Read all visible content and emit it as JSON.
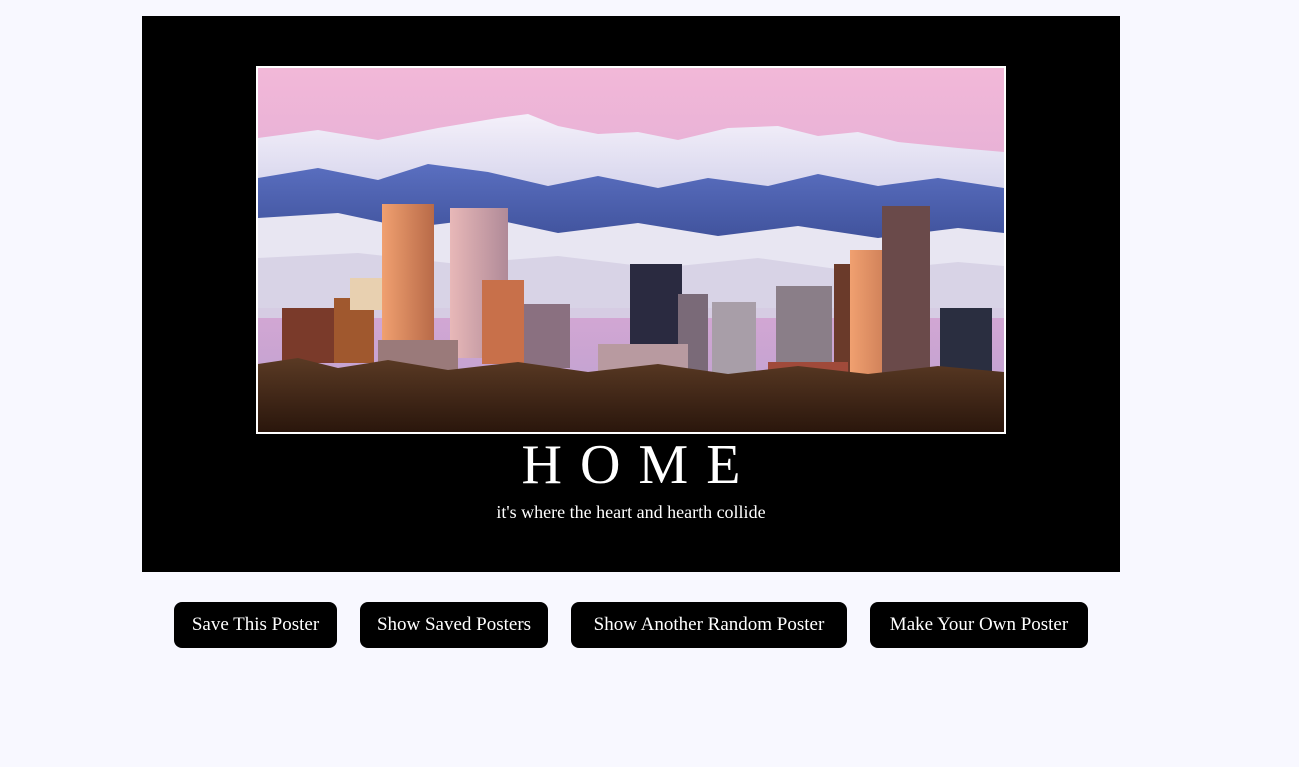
{
  "poster": {
    "image_alt": "Denver skyline with snow-capped Rocky Mountains at dusk",
    "title": "HOME",
    "quote": "it's where the heart and hearth collide"
  },
  "buttons": {
    "save": "Save This Poster",
    "show_saved": "Show Saved Posters",
    "random": "Show Another Random Poster",
    "make_own": "Make Your Own Poster"
  },
  "colors": {
    "background": "#f8f8ff",
    "poster_background": "#000000",
    "button_background": "#000000",
    "text_light": "#ffffff"
  }
}
